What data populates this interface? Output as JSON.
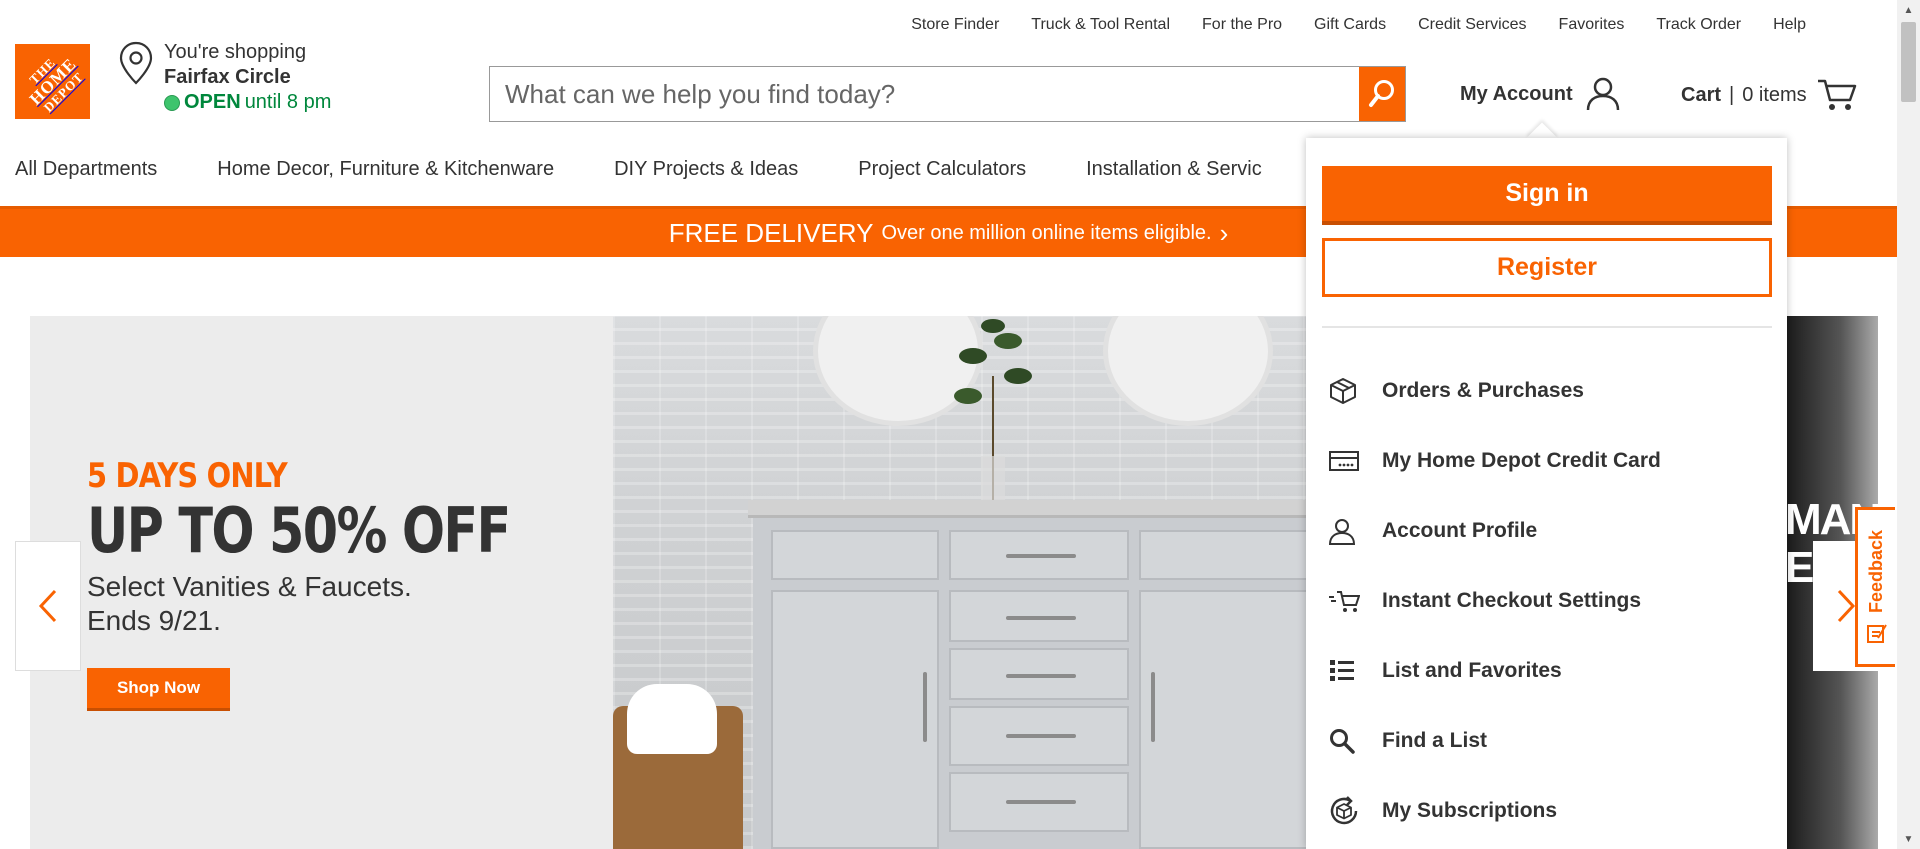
{
  "util_nav": [
    "Store Finder",
    "Truck & Tool Rental",
    "For the Pro",
    "Gift Cards",
    "Credit Services",
    "Favorites",
    "Track Order",
    "Help"
  ],
  "logo": {
    "line1": "THE",
    "line2": "HOME",
    "line3": "DEPOT"
  },
  "store": {
    "shopping_label": "You're shopping",
    "name": "Fairfax Circle",
    "open_word": "OPEN",
    "open_until": "until 8 pm"
  },
  "search": {
    "placeholder": "What can we help you find today?"
  },
  "account": {
    "label": "My Account"
  },
  "cart": {
    "label": "Cart",
    "separator": "|",
    "count": "0 items"
  },
  "main_nav": [
    "All Departments",
    "Home Decor, Furniture & Kitchenware",
    "DIY Projects & Ideas",
    "Project Calculators",
    "Installation & Servic"
  ],
  "delivery": {
    "headline": "FREE DELIVERY",
    "detail": "Over one million online items eligible.",
    "chevron": "›"
  },
  "hero": {
    "kicker": "5 DAYS ONLY",
    "headline": "UP TO 50% OFF",
    "sub1": "Select Vanities & Faucets.",
    "sub2": "Ends 9/21.",
    "cta": "Shop Now",
    "right_text": "MAN\nEL"
  },
  "feedback": {
    "label": "Feedback"
  },
  "dropdown": {
    "signin": "Sign in",
    "register": "Register",
    "items": [
      {
        "label": "Orders & Purchases",
        "icon": "box-icon"
      },
      {
        "label": "My Home Depot Credit Card",
        "icon": "credit-card-icon"
      },
      {
        "label": "Account Profile",
        "icon": "user-icon"
      },
      {
        "label": "Instant Checkout Settings",
        "icon": "fast-cart-icon"
      },
      {
        "label": "List and Favorites",
        "icon": "list-icon"
      },
      {
        "label": "Find a List",
        "icon": "search-icon"
      },
      {
        "label": "My Subscriptions",
        "icon": "subscription-icon"
      }
    ]
  },
  "colors": {
    "brand": "#f96302",
    "open_green": "#00873c"
  }
}
